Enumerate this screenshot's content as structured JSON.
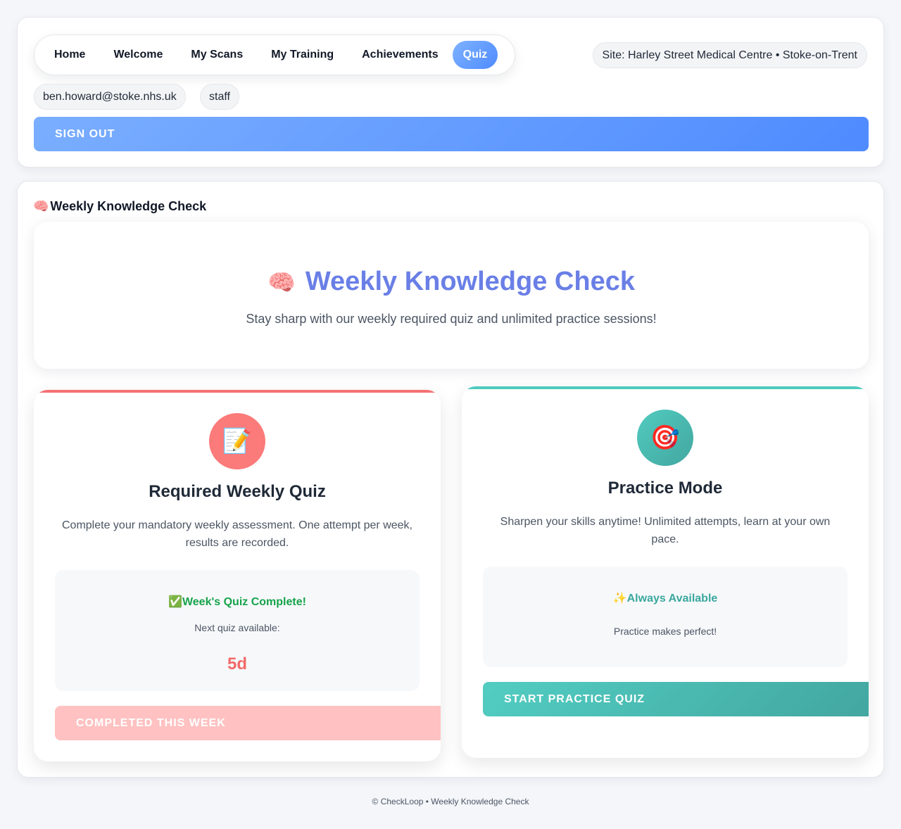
{
  "nav": {
    "items": [
      {
        "label": "Home",
        "active": false
      },
      {
        "label": "Welcome",
        "active": false
      },
      {
        "label": "My Scans",
        "active": false
      },
      {
        "label": "My Training",
        "active": false
      },
      {
        "label": "Achievements",
        "active": false
      },
      {
        "label": "Quiz",
        "active": true
      }
    ]
  },
  "site": {
    "label": "Site: Harley Street Medical Centre • Stoke-on-Trent"
  },
  "user": {
    "email": "ben.howard@stoke.nhs.uk",
    "role": "staff"
  },
  "header": {
    "sign_out_label": "SIGN OUT"
  },
  "section": {
    "icon": "🧠",
    "title": "Weekly Knowledge Check"
  },
  "hero": {
    "icon": "🧠",
    "title": "Weekly Knowledge Check",
    "subtitle": "Stay sharp with our weekly required quiz and unlimited practice sessions!"
  },
  "required_quiz": {
    "icon": "📝",
    "title": "Required Weekly Quiz",
    "description": "Complete your mandatory weekly assessment. One attempt per week, results are recorded.",
    "status_icon": "✅",
    "status_title": "Week's Quiz Complete!",
    "next_label": "Next quiz available:",
    "countdown": "5d",
    "button_label": "COMPLETED THIS WEEK",
    "accent_color": "#f47173"
  },
  "practice": {
    "icon": "🎯",
    "title": "Practice Mode",
    "description": "Sharpen your skills anytime! Unlimited attempts, learn at your own pace.",
    "status_icon": "✨",
    "status_title": "Always Available",
    "note": "Practice makes perfect!",
    "button_label": "START PRACTICE QUIZ",
    "accent_color": "#4ecbbf"
  },
  "footer": {
    "text": "© CheckLoop • Weekly Knowledge Check"
  }
}
